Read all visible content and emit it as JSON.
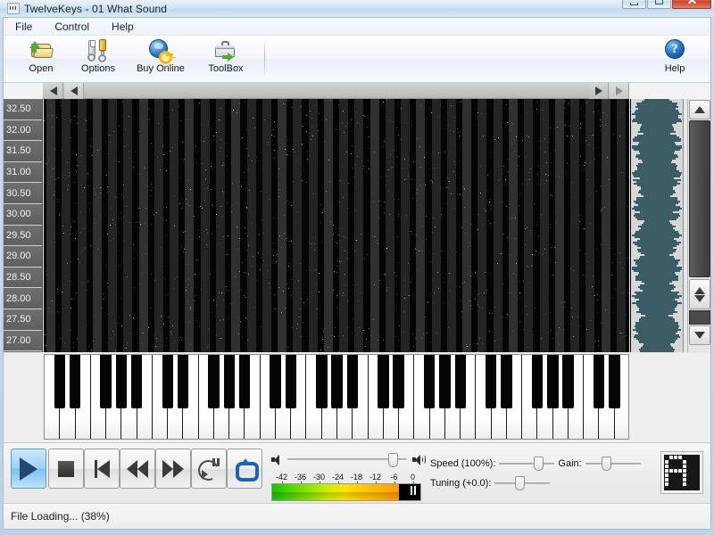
{
  "window": {
    "title": "TwelveKeys - 01 What Sound",
    "icon": "app-icon",
    "controls": {
      "minimize": "–",
      "maximize": "❐",
      "close": "✕"
    }
  },
  "menu": {
    "items": [
      "File",
      "Control",
      "Help"
    ]
  },
  "toolbar": {
    "buttons": [
      {
        "label": "Open",
        "icon": "open-folder-icon"
      },
      {
        "label": "Options",
        "icon": "wrench-screwdriver-icon"
      },
      {
        "label": "Buy Online",
        "icon": "globe-key-icon"
      },
      {
        "label": "ToolBox",
        "icon": "toolbox-icon"
      }
    ],
    "help": {
      "label": "Help",
      "icon": "help-question-icon"
    }
  },
  "navigation": {
    "left_buttons": [
      "scroll-left-page",
      "scroll-left-step"
    ],
    "right_buttons": [
      "scroll-right-step",
      "scroll-right-page"
    ]
  },
  "timeline": {
    "ticks": [
      "32.50",
      "32.00",
      "31.50",
      "31.00",
      "30.50",
      "30.00",
      "29.50",
      "29.00",
      "28.50",
      "28.00",
      "27.50",
      "27.00"
    ]
  },
  "transport": {
    "buttons": [
      {
        "name": "play",
        "label": "Play",
        "active": true
      },
      {
        "name": "stop",
        "label": "Stop",
        "active": false
      },
      {
        "name": "skip-start",
        "label": "Skip to Start",
        "active": false
      },
      {
        "name": "rewind",
        "label": "Rewind",
        "active": false
      },
      {
        "name": "fast-forward",
        "label": "Fast Forward",
        "active": false
      },
      {
        "name": "loop-pause",
        "label": "Loop Pause",
        "active": false
      },
      {
        "name": "repeat",
        "label": "Repeat",
        "active": false
      }
    ]
  },
  "volume": {
    "value_percent": 88
  },
  "meter": {
    "labels": [
      "-42",
      "-36",
      "-30",
      "-24",
      "-18",
      "-12",
      "-6",
      "0"
    ],
    "fill_percent": 86,
    "unit": "dB"
  },
  "controls": {
    "speed": {
      "label": "Speed (100%):",
      "value_percent": 70
    },
    "gain": {
      "label": "Gain:",
      "value_percent": 38
    },
    "tuning": {
      "label": "Tuning (+0.0):",
      "value_percent": 45
    }
  },
  "note_display": {
    "name": "note-readout"
  },
  "status": {
    "text": "File Loading... (38%)"
  },
  "colors": {
    "accent": "#1c63b0",
    "waveform": "#3d5d66",
    "meter_green": "#19c400",
    "meter_orange": "#ff9b00",
    "close_button": "#c8462f"
  }
}
